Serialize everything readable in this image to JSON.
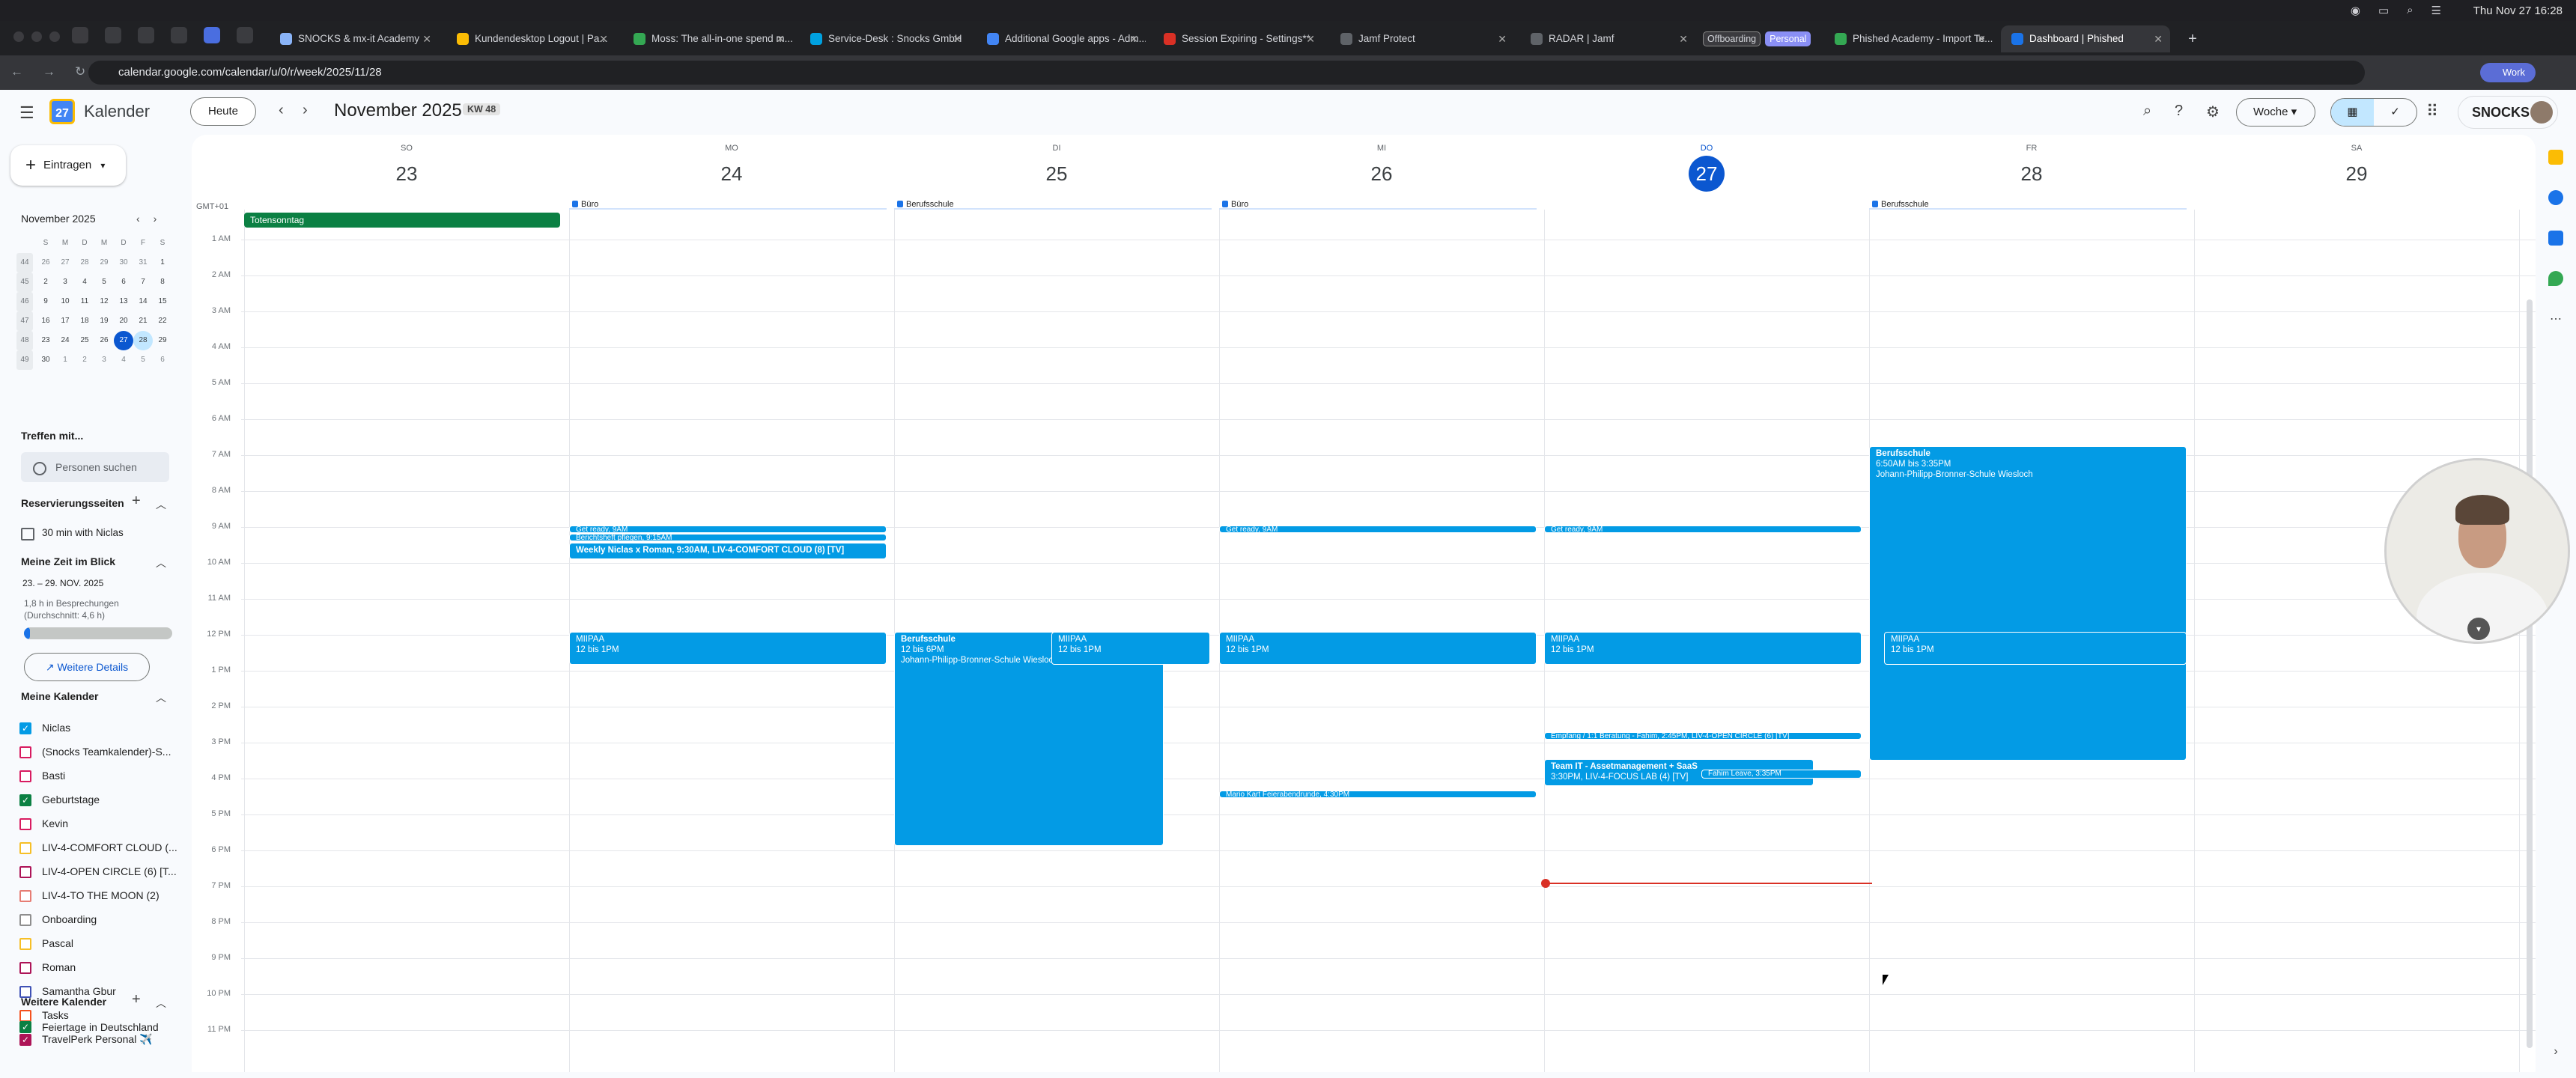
{
  "menubar": {
    "clock": "Thu Nov 27  16:28"
  },
  "browser": {
    "tabs": [
      {
        "label": "SNOCKS & mx-it Academy"
      },
      {
        "label": "Kundendesktop Logout | Pa..."
      },
      {
        "label": "Moss: The all-in-one spend m..."
      },
      {
        "label": "Service-Desk : Snocks GmbH"
      },
      {
        "label": "Additional Google apps - Adm..."
      },
      {
        "label": "Session Expiring - Settings**"
      },
      {
        "label": "Jamf Protect"
      },
      {
        "label": "RADAR | Jamf"
      },
      {
        "label": "Phished Academy - Import Te..."
      },
      {
        "label": "Dashboard | Phished"
      }
    ],
    "group_pills": [
      "Offboarding",
      "Personal"
    ],
    "url": "calendar.google.com/calendar/u/0/r/week/2025/11/28",
    "profile": "Work"
  },
  "header": {
    "app_title": "Kalender",
    "today_button": "Heute",
    "period": "November 2025",
    "week_badge": "KW 48",
    "view": "Woche",
    "org": "SNOCKS"
  },
  "sidebar": {
    "create": "Eintragen",
    "mini": {
      "title": "November 2025",
      "headers": [
        "S",
        "M",
        "D",
        "M",
        "D",
        "F",
        "S"
      ],
      "weeks": [
        {
          "wk": "44",
          "days": [
            "26",
            "27",
            "28",
            "29",
            "30",
            "31",
            "1"
          ]
        },
        {
          "wk": "45",
          "days": [
            "2",
            "3",
            "4",
            "5",
            "6",
            "7",
            "8"
          ]
        },
        {
          "wk": "46",
          "days": [
            "9",
            "10",
            "11",
            "12",
            "13",
            "14",
            "15"
          ]
        },
        {
          "wk": "47",
          "days": [
            "16",
            "17",
            "18",
            "19",
            "20",
            "21",
            "22"
          ]
        },
        {
          "wk": "48",
          "days": [
            "23",
            "24",
            "25",
            "26",
            "27",
            "28",
            "29"
          ]
        },
        {
          "wk": "49",
          "days": [
            "30",
            "1",
            "2",
            "3",
            "4",
            "5",
            "6"
          ]
        }
      ]
    },
    "meet_title": "Treffen mit...",
    "people_search": "Personen suchen",
    "booking_title": "Reservierungsseiten",
    "booking_item": "30 min with Niclas",
    "time_title": "Meine Zeit im Blick",
    "time_range": "23. – 29. NOV. 2025",
    "time_note_1": "1,8 h in Besprechungen",
    "time_note_2": "(Durchschnitt: 4,6 h)",
    "time_fraction": 0.04,
    "details_button": "Weitere Details",
    "my_cals_title": "Meine Kalender",
    "calendars": [
      {
        "name": "Niclas",
        "checked": true,
        "color": "#039be5"
      },
      {
        "name": "(Snocks Teamkalender)-S...",
        "checked": false,
        "color": "#d81b60"
      },
      {
        "name": "Basti",
        "checked": false,
        "color": "#d81b60"
      },
      {
        "name": "Geburtstage",
        "checked": true,
        "color": "#0b8043"
      },
      {
        "name": "Kevin",
        "checked": false,
        "color": "#d81b60"
      },
      {
        "name": "LIV-4-COMFORT CLOUD (...",
        "checked": false,
        "color": "#f6bf26"
      },
      {
        "name": "LIV-4-OPEN CIRCLE (6) [T...",
        "checked": false,
        "color": "#ad1457"
      },
      {
        "name": "LIV-4-TO THE MOON (2)",
        "checked": false,
        "color": "#e67c73"
      },
      {
        "name": "Onboarding",
        "checked": false,
        "color": "#8e8e8e"
      },
      {
        "name": "Pascal",
        "checked": false,
        "color": "#f6bf26"
      },
      {
        "name": "Roman",
        "checked": false,
        "color": "#ad1457"
      },
      {
        "name": "Samantha Gbur",
        "checked": false,
        "color": "#3f51b5"
      },
      {
        "name": "Tasks",
        "checked": false,
        "color": "#f4511e"
      },
      {
        "name": "TravelPerk Personal ✈️",
        "checked": true,
        "color": "#ad1457"
      }
    ],
    "other_title": "Weitere Kalender",
    "holiday_cal": "Feiertage in Deutschland"
  },
  "week": {
    "gmt": "GMT+01",
    "days": [
      {
        "name": "SO",
        "num": "23"
      },
      {
        "name": "MO",
        "num": "24"
      },
      {
        "name": "DI",
        "num": "25"
      },
      {
        "name": "MI",
        "num": "26"
      },
      {
        "name": "DO",
        "num": "27"
      },
      {
        "name": "FR",
        "num": "28"
      },
      {
        "name": "SA",
        "num": "29"
      }
    ],
    "hours": [
      "1 AM",
      "2 AM",
      "3 AM",
      "4 AM",
      "5 AM",
      "6 AM",
      "7 AM",
      "8 AM",
      "9 AM",
      "10 AM",
      "11 AM",
      "12 PM",
      "1 PM",
      "2 PM",
      "3 PM",
      "4 PM",
      "5 PM",
      "6 PM",
      "7 PM",
      "8 PM",
      "9 PM",
      "10 PM",
      "11 PM"
    ],
    "allday": {
      "holiday": "Totensonntag",
      "mo": "Büro",
      "di": "Berufsschule",
      "mi": "Büro",
      "fr": "Berufsschule"
    },
    "events": {
      "fr_school_t": "Berufsschule",
      "fr_school_d": "6:50AM bis 3:35PM",
      "fr_school_l": "Johann-Philipp-Bronner-Schule Wiesloch",
      "mo_ready": "Get ready, 9AM",
      "mo_report": "Berichtsheft pflegen, 9:15AM",
      "mo_weekly": "Weekly Niclas x Roman, 9:30AM, LIV-4-COMFORT CLOUD (8) [TV]",
      "mi_ready": "Get ready, 9AM",
      "do_ready": "Get ready, 9AM",
      "miipaa": "MIIPAA",
      "miipaa_time": "12 bis 1PM",
      "di_school_t": "Berufsschule",
      "di_school_d": "12 bis 6PM",
      "di_school_l": "Johann-Philipp-Bronner-Schule Wiesloch",
      "do_empfang": "Empfang / 1:1 Beratung - Fahim, 2:45PM, LIV-4-OPEN CIRCLE (6) [TV]",
      "do_team_t": "Team IT - Assetmanagement + SaaS",
      "do_team_d": "3:30PM, LIV-4-FOCUS LAB (4) [TV]",
      "do_leave": "Fahim Leave, 3:35PM",
      "mi_mario": "Mario Kart Feierabendrunde, 4:30PM"
    }
  }
}
